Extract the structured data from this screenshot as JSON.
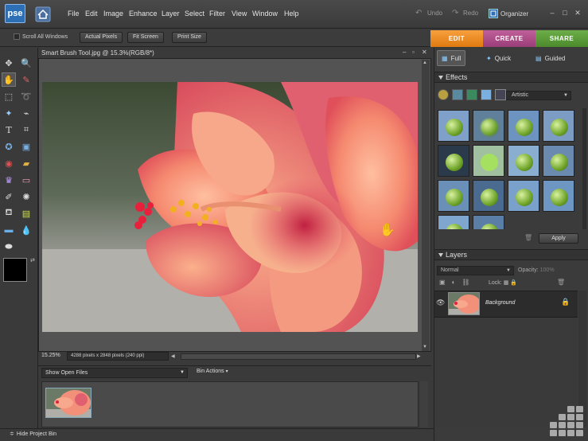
{
  "app": {
    "logo_text": "pse"
  },
  "menu": [
    "File",
    "Edit",
    "Image",
    "Enhance",
    "Layer",
    "Select",
    "Filter",
    "View",
    "Window",
    "Help"
  ],
  "toolbar_right": {
    "undo": "Undo",
    "redo": "Redo",
    "organizer": "Organizer"
  },
  "options": {
    "scroll_all": "Scroll All Windows",
    "actual_pixels": "Actual Pixels",
    "fit_screen": "Fit Screen",
    "print_size": "Print Size"
  },
  "modes": {
    "edit": "EDIT",
    "create": "CREATE",
    "share": "SHARE"
  },
  "document": {
    "title": "Smart Brush Tool.jpg @ 15.3%(RGB/8*)",
    "zoom": "15.25%",
    "info": "4288 pixels x 2848 pixels (240 ppi)"
  },
  "bin": {
    "show_open": "Show Open Files",
    "bin_actions": "Bin Actions",
    "hide_label": "Hide Project Bin"
  },
  "subtabs": {
    "full": "Full",
    "quick": "Quick",
    "guided": "Guided"
  },
  "effects": {
    "header": "Effects",
    "category": "Artistic",
    "apply": "Apply"
  },
  "layers": {
    "header": "Layers",
    "blend_mode": "Normal",
    "opacity_label": "Opacity:",
    "opacity_value": "100%",
    "lock_label": "Lock:",
    "layer_name": "Background"
  },
  "colors": {
    "edit_tab": "#f08a1c",
    "create_tab": "#b04a8a",
    "share_tab": "#5a9a3a",
    "accent": "#2d6fb5"
  }
}
